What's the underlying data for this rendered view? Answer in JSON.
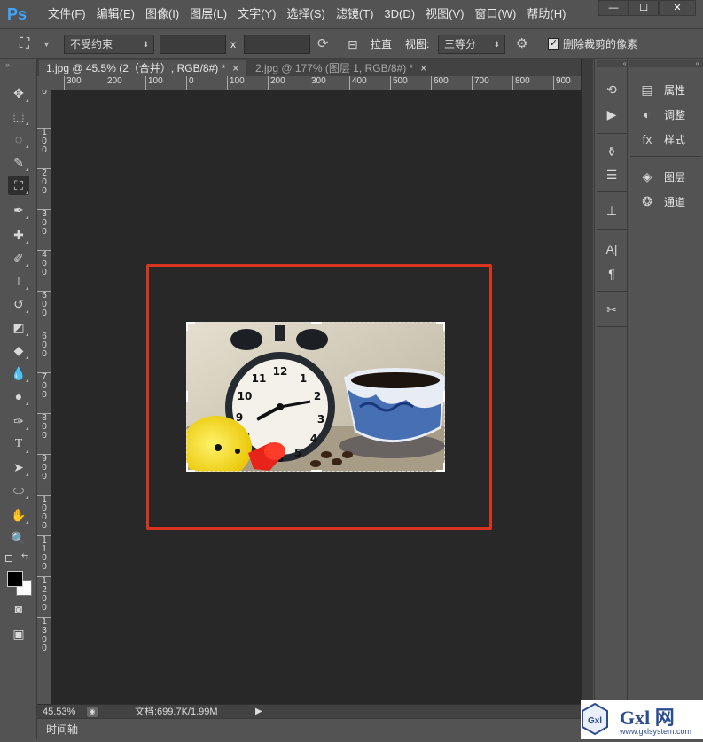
{
  "app": {
    "logo": "Ps",
    "accent": "#3ba7ff"
  },
  "menu": [
    "文件(F)",
    "编辑(E)",
    "图像(I)",
    "图层(L)",
    "文字(Y)",
    "选择(S)",
    "滤镜(T)",
    "3D(D)",
    "视图(V)",
    "窗口(W)",
    "帮助(H)"
  ],
  "window_controls": {
    "minimize": "—",
    "maximize": "☐",
    "close": "✕"
  },
  "options": {
    "ratio_value": "不受约束",
    "x_label": "x",
    "straighten_label": "拉直",
    "view_label": "视图:",
    "view_value": "三等分",
    "delete_cropped_label": "删除裁剪的像素",
    "delete_cropped_checked": true
  },
  "tabs": [
    {
      "label": "1.jpg @ 45.5% (2（合并）, RGB/8#) *",
      "close": "×",
      "active": true
    },
    {
      "label": "2.jpg @ 177% (图层 1, RGB/8#) *",
      "close": "×",
      "active": false
    }
  ],
  "hruler_labels": [
    "300",
    "200",
    "100",
    "0",
    "100",
    "200",
    "300",
    "400",
    "500",
    "600",
    "700",
    "800",
    "900"
  ],
  "vruler_labels": [
    "0",
    "1\n0\n0",
    "2\n0\n0",
    "3\n0\n0",
    "4\n0\n0",
    "5\n0\n0",
    "6\n0\n0",
    "7\n0\n0",
    "8\n0\n0",
    "9\n0\n0",
    "1\n0\n0\n0",
    "1\n1\n0\n0",
    "1\n2\n0\n0",
    "1\n3\n0\n0"
  ],
  "panels": [
    {
      "icon": "properties-icon",
      "label": "属性"
    },
    {
      "icon": "adjustments-icon",
      "label": "调整"
    },
    {
      "icon": "styles-icon",
      "label": "样式"
    },
    {
      "icon": "layers-icon",
      "label": "图层"
    },
    {
      "icon": "channels-icon",
      "label": "通道"
    }
  ],
  "status": {
    "zoom": "45.53%",
    "doc_info": "文档:699.7K/1.99M"
  },
  "timeline_label": "时间轴",
  "watermark": {
    "text": "Gxl 网",
    "url": "www.gxlsystem.com"
  },
  "colors": {
    "highlight": "#d9341f",
    "canvas_bg": "#282828",
    "ui_bg": "#535353"
  }
}
